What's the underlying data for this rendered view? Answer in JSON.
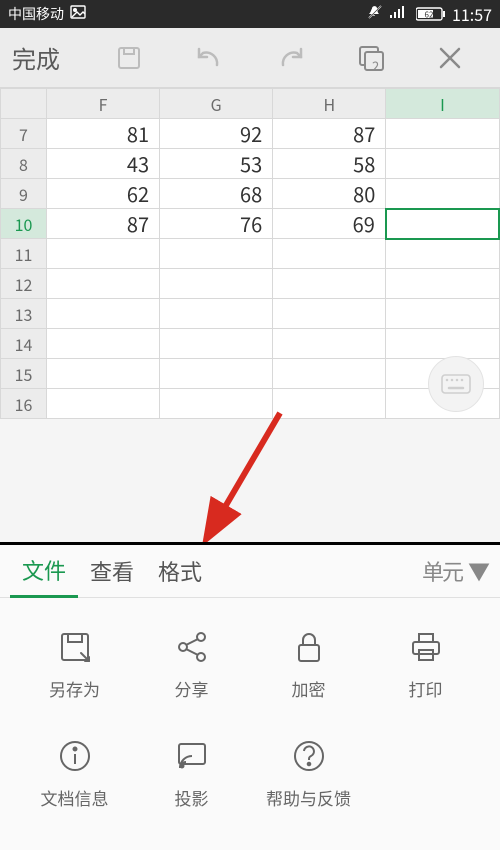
{
  "status_bar": {
    "carrier": "中国移动",
    "battery": "62",
    "time": "11:57"
  },
  "toolbar": {
    "done_label": "完成",
    "tab_count": "2"
  },
  "chart_data": {
    "type": "table",
    "columns": [
      "F",
      "G",
      "H",
      "I"
    ],
    "rows": [
      {
        "n": "7",
        "F": "81",
        "G": "92",
        "H": "87",
        "I": ""
      },
      {
        "n": "8",
        "F": "43",
        "G": "53",
        "H": "58",
        "I": ""
      },
      {
        "n": "9",
        "F": "62",
        "G": "68",
        "H": "80",
        "I": ""
      },
      {
        "n": "10",
        "F": "87",
        "G": "76",
        "H": "69",
        "I": ""
      },
      {
        "n": "11",
        "F": "",
        "G": "",
        "H": "",
        "I": ""
      },
      {
        "n": "12",
        "F": "",
        "G": "",
        "H": "",
        "I": ""
      },
      {
        "n": "13",
        "F": "",
        "G": "",
        "H": "",
        "I": ""
      },
      {
        "n": "14",
        "F": "",
        "G": "",
        "H": "",
        "I": ""
      },
      {
        "n": "15",
        "F": "",
        "G": "",
        "H": "",
        "I": ""
      },
      {
        "n": "16",
        "F": "",
        "G": "",
        "H": "",
        "I": ""
      }
    ],
    "selected_cell": "I10",
    "selected_column": "I",
    "selected_row": "10"
  },
  "tabs": {
    "file": "文件",
    "view": "查看",
    "format": "格式",
    "more": "单元"
  },
  "file_actions": {
    "row1": [
      {
        "id": "save-as",
        "label": "另存为"
      },
      {
        "id": "share",
        "label": "分享"
      },
      {
        "id": "encrypt",
        "label": "加密"
      },
      {
        "id": "print",
        "label": "打印"
      }
    ],
    "row2": [
      {
        "id": "doc-info",
        "label": "文档信息"
      },
      {
        "id": "project",
        "label": "投影"
      },
      {
        "id": "help",
        "label": "帮助与反馈"
      }
    ]
  }
}
